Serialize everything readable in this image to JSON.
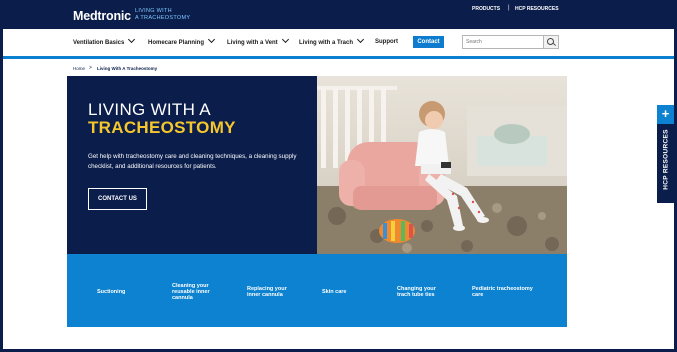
{
  "header": {
    "brand": "Medtronic",
    "brand_sub_line1": "LIVING WITH",
    "brand_sub_line2": "A TRACHEOSTOMY",
    "products": "PRODUCTS",
    "separator": "|",
    "hcp_resources": "HCP RESOURCES"
  },
  "nav": {
    "items": [
      {
        "label": "Ventilation Basics"
      },
      {
        "label": "Homecare Planning"
      },
      {
        "label": "Living with a Vent"
      },
      {
        "label": "Living with a Trach"
      },
      {
        "label": "Support"
      }
    ],
    "contact": "Contact",
    "search_placeholder": "Search"
  },
  "breadcrumb": {
    "home": "Home",
    "separator": ">",
    "current": "Living With A Tracheostomy"
  },
  "hero": {
    "title_line1": "LIVING WITH A",
    "title_line2": "TRACHEOSTOMY",
    "description": "Get help with tracheostomy care and cleaning techniques, a cleaning supply checklist, and additional resources for patients.",
    "button": "CONTACT US"
  },
  "topics": [
    {
      "label": "Suctioning"
    },
    {
      "label": "Cleaning your reusable inner cannula"
    },
    {
      "label": "Replacing your inner cannula"
    },
    {
      "label": "Skin care"
    },
    {
      "label": "Changing your trach tube ties"
    },
    {
      "label": "Pediatric tracheostomy care"
    }
  ],
  "side_tab": {
    "plus": "+",
    "label": "HCP RESOURCES"
  },
  "colors": {
    "navy": "#0b1d4b",
    "accent_blue": "#0d82d0",
    "title_yellow": "#f6c72c"
  }
}
